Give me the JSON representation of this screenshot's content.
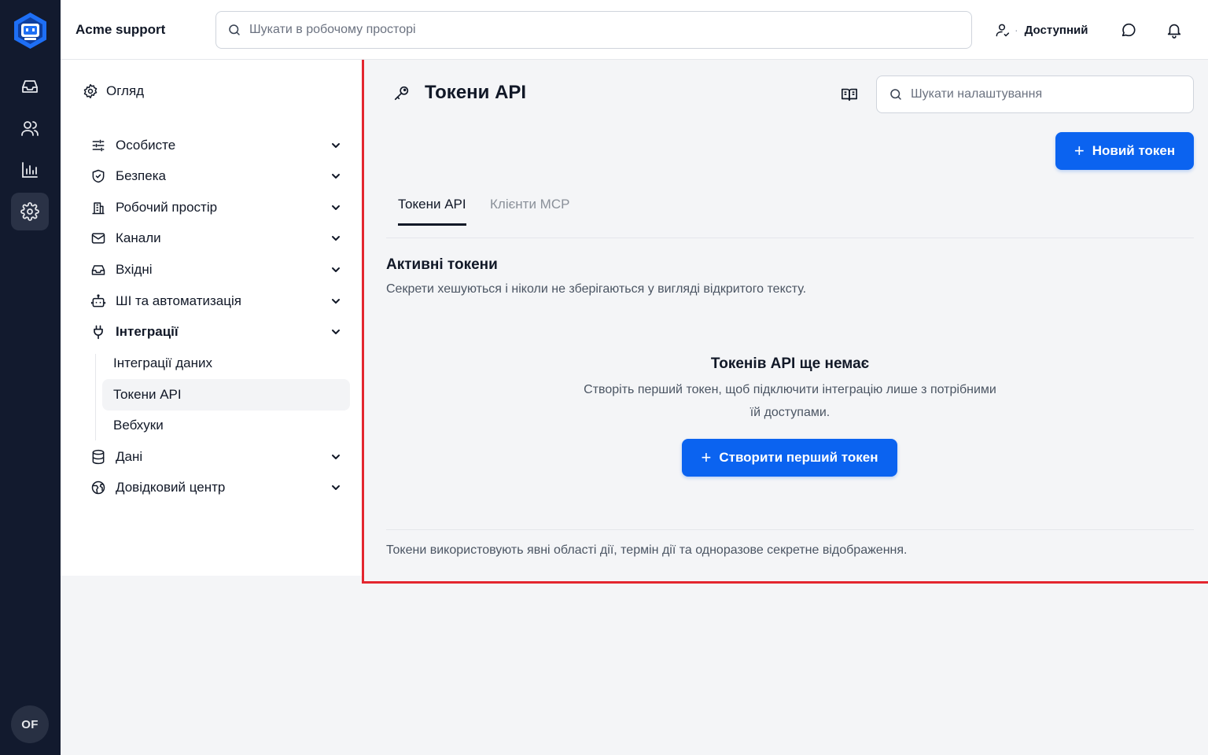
{
  "app": {
    "brand": "Acme support",
    "user_initials": "OF",
    "accent_color": "#0b63f0",
    "rail_color": "#121a2e",
    "highlight_border_color": "#e3262f"
  },
  "rail": {
    "items": [
      {
        "name": "inbox",
        "icon": "inbox-icon"
      },
      {
        "name": "contacts",
        "icon": "users-icon"
      },
      {
        "name": "reports",
        "icon": "bar-chart-icon"
      },
      {
        "name": "settings",
        "icon": "gear-icon",
        "active": true
      }
    ]
  },
  "topbar": {
    "search_placeholder": "Шукати в робочому просторі",
    "status_label": "Доступний",
    "status_separator": "·"
  },
  "subnav": {
    "overview": "Огляд",
    "items": [
      {
        "label": "Особисте",
        "icon": "sliders-icon"
      },
      {
        "label": "Безпека",
        "icon": "shield-icon"
      },
      {
        "label": "Робочий простір",
        "icon": "building-icon"
      },
      {
        "label": "Канали",
        "icon": "mail-icon"
      },
      {
        "label": "Вхідні",
        "icon": "inbox-icon"
      },
      {
        "label": "ШІ та автоматизація",
        "icon": "bot-icon"
      },
      {
        "label": "Інтеграції",
        "icon": "plug-icon",
        "expanded": true
      },
      {
        "label": "Дані",
        "icon": "database-icon"
      },
      {
        "label": "Довідковий центр",
        "icon": "globe-icon"
      }
    ],
    "integrations_children": [
      {
        "label": "Інтеграції даних"
      },
      {
        "label": "Токени API",
        "active": true
      },
      {
        "label": "Вебхуки"
      }
    ]
  },
  "main": {
    "title": "Токени API",
    "settings_search_placeholder": "Шукати налаштування",
    "new_token_button": "Новий токен",
    "tabs": [
      {
        "label": "Токени API",
        "active": true
      },
      {
        "label": "Клієнти MCP",
        "active": false
      }
    ],
    "section_title": "Активні токени",
    "section_subtitle": "Секрети хешуються і ніколи не зберігаються у вигляді відкритого тексту.",
    "empty_title": "Токенів API ще немає",
    "empty_description": "Створіть перший токен, щоб підключити інтеграцію лише з потрібними їй доступами.",
    "create_first_button": "Створити перший токен",
    "footer_note": "Токени використовують явні області дії, термін дії та одноразове секретне відображення."
  }
}
